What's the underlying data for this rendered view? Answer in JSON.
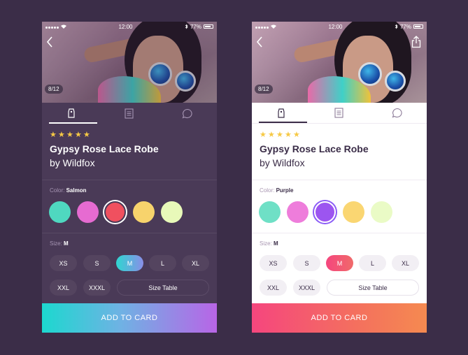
{
  "status": {
    "time": "12:00",
    "battery": "77%"
  },
  "gallery": {
    "counter": "8/12"
  },
  "product": {
    "rating": 5,
    "title": "Gypsy Rose Lace Robe",
    "brand": "by Wildfox"
  },
  "screens": [
    {
      "theme": "dark",
      "color_label": "Color:",
      "color_selected": "Salmon",
      "swatches": [
        "#4fd8c0",
        "#e66bd1",
        "#f0505f",
        "#f7d36c",
        "#e8f9b9"
      ],
      "selected_swatch_index": 2,
      "size_label": "Size:",
      "size_selected": "M",
      "sizes": [
        "XS",
        "S",
        "M",
        "L",
        "XL",
        "XXL",
        "XXXL"
      ],
      "size_table": "Size Table",
      "add_button": "ADD TO CARD"
    },
    {
      "theme": "light",
      "color_label": "Color:",
      "color_selected": "Purple",
      "swatches": [
        "#6fe0c6",
        "#ee7ddb",
        "#9c55f0",
        "#fad672",
        "#eafbc6"
      ],
      "selected_swatch_index": 2,
      "size_label": "Size:",
      "size_selected": "M",
      "sizes": [
        "XS",
        "S",
        "M",
        "L",
        "XL",
        "XXL",
        "XXXL"
      ],
      "size_table": "Size Table",
      "add_button": "ADD TO CARD"
    }
  ],
  "colors": {
    "background": "#3b2d48",
    "dark_panel": "#4a3a57",
    "star": "#f6c945",
    "dark_gradient": [
      "#1cd8cf",
      "#b865e6"
    ],
    "light_gradient": [
      "#f5467e",
      "#f58a50"
    ]
  },
  "icons": {
    "back": "chevron-left-icon",
    "share": "share-icon",
    "tabs": [
      "tag-icon",
      "document-icon",
      "chat-bubble-icon"
    ]
  }
}
